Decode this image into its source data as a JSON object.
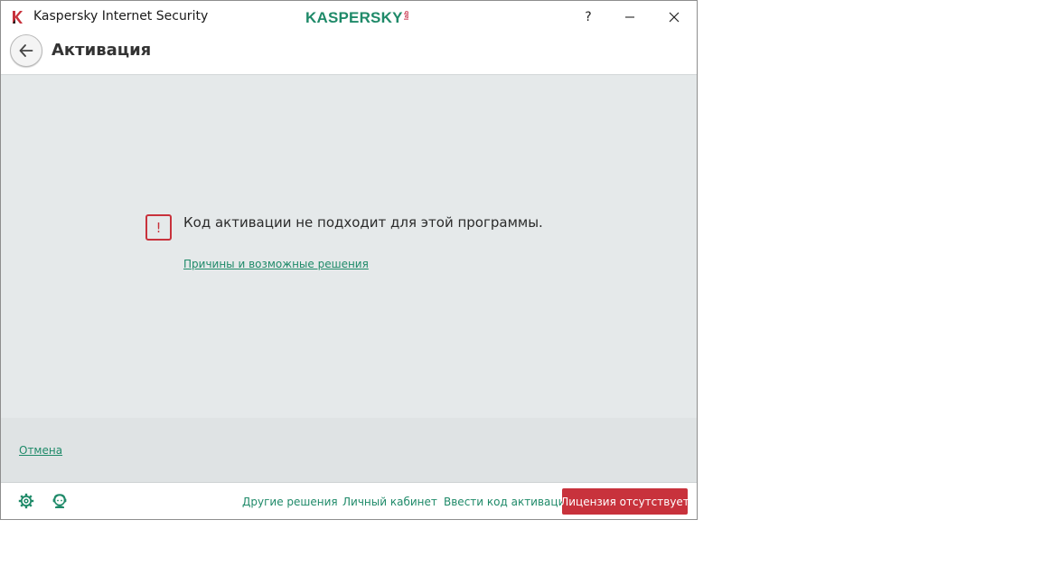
{
  "window": {
    "title": "Kaspersky Internet Security",
    "logo": {
      "text": "KASPERSKY",
      "lab": "lab"
    },
    "controls": {
      "help": "?",
      "minimize": "—",
      "close": "✕"
    }
  },
  "header": {
    "back_icon": "arrow-left-icon",
    "title": "Активация"
  },
  "content": {
    "error_icon": "!",
    "error_message": "Код активации не подходит для этой программы.",
    "reasons_link": "Причины и возможные решения"
  },
  "actions": {
    "cancel": "Отмена"
  },
  "footer": {
    "settings_icon": "gear-icon",
    "support_icon": "support-icon",
    "links": {
      "other_solutions": "Другие решения",
      "my_account": "Личный кабинет",
      "enter_code": "Ввести код активации"
    },
    "license_button": "Лицензия отсутствует"
  },
  "colors": {
    "accent": "#1f8a69",
    "danger": "#c8323c",
    "content_bg": "#e5e9ea"
  }
}
